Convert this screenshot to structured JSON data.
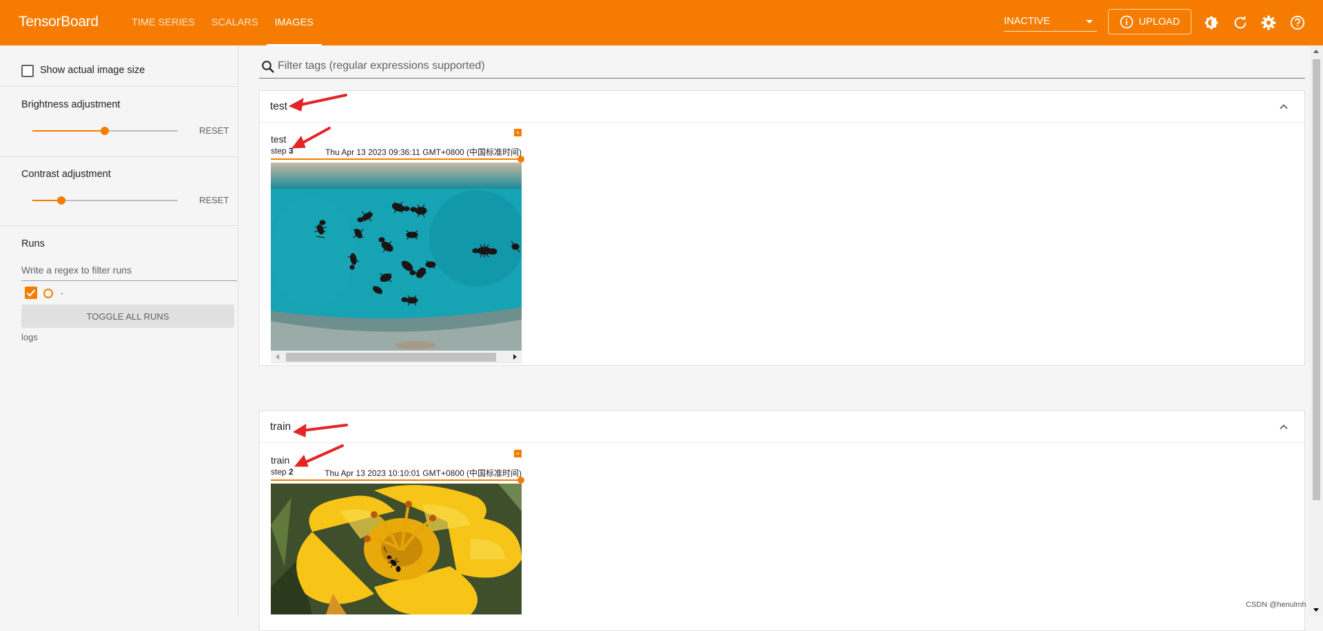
{
  "app": {
    "title": "TensorBoard"
  },
  "nav": {
    "tabs": [
      {
        "label": "TIME SERIES"
      },
      {
        "label": "SCALARS"
      },
      {
        "label": "IMAGES"
      }
    ]
  },
  "header": {
    "run_status": "INACTIVE",
    "upload_label": "UPLOAD"
  },
  "colors": {
    "brand": "#f57c00",
    "accent_red": "#e53935"
  },
  "sidebar": {
    "show_actual_size_label": "Show actual image size",
    "brightness": {
      "label": "Brightness adjustment",
      "reset": "RESET",
      "value_fraction": 0.5
    },
    "contrast": {
      "label": "Contrast adjustment",
      "reset": "RESET",
      "value_fraction": 0.2
    },
    "runs": {
      "title": "Runs",
      "filter_placeholder": "Write a regex to filter runs",
      "items": [
        {
          "name": "."
        }
      ],
      "toggle_all": "TOGGLE ALL RUNS",
      "logdir": "logs"
    }
  },
  "main": {
    "filter_placeholder": "Filter tags (regular expressions supported)",
    "groups": [
      {
        "title": "test",
        "card": {
          "name": "test",
          "step_label": "step",
          "step_value": "3",
          "time": "Thu Apr 13 2023 09:36:11 GMT+0800 (中国标准时间)"
        }
      },
      {
        "title": "train",
        "card": {
          "name": "train",
          "step_label": "step",
          "step_value": "2",
          "time": "Thu Apr 13 2023 10:10:01 GMT+0800 (中国标准时间)"
        }
      }
    ]
  },
  "watermark": "CSDN @henulmh"
}
